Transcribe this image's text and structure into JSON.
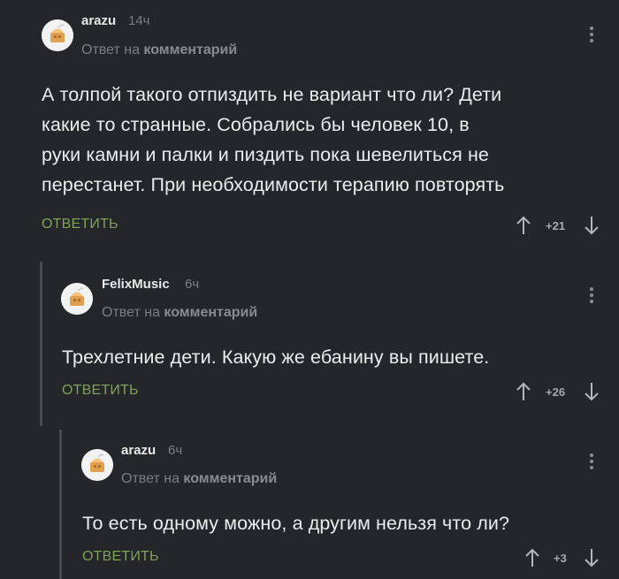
{
  "colors": {
    "background": "#252629",
    "accent_reply": "#7fa35a",
    "thread_line": "#4a4b4e",
    "muted": "#7d7e82"
  },
  "comments": [
    {
      "username": "arazu",
      "time": "14ч",
      "reply_prefix": "Ответ на",
      "reply_target": "комментарий",
      "lines": [
        "А толпой такого отпиздить не вариант что ли? Дети",
        "какие то странные. Собрались бы человек 10, в",
        "руки камни и палки и пиздить пока шевелиться не",
        "перестанет. При необходимости терапию повторять"
      ],
      "reply_label": "ОТВЕТИТЬ",
      "score": "+21"
    },
    {
      "username": "FelixMusic",
      "time": "6ч",
      "reply_prefix": "Ответ на",
      "reply_target": "комментарий",
      "lines": [
        "Трехлетние дети. Какую же ебанину вы пишете."
      ],
      "reply_label": "ОТВЕТИТЬ",
      "score": "+26"
    },
    {
      "username": "arazu",
      "time": "6ч",
      "reply_prefix": "Ответ на",
      "reply_target": "комментарий",
      "lines": [
        "То есть одному можно, а другим нельзя что ли?"
      ],
      "reply_label": "ОТВЕТИТЬ",
      "score": "+3"
    }
  ]
}
